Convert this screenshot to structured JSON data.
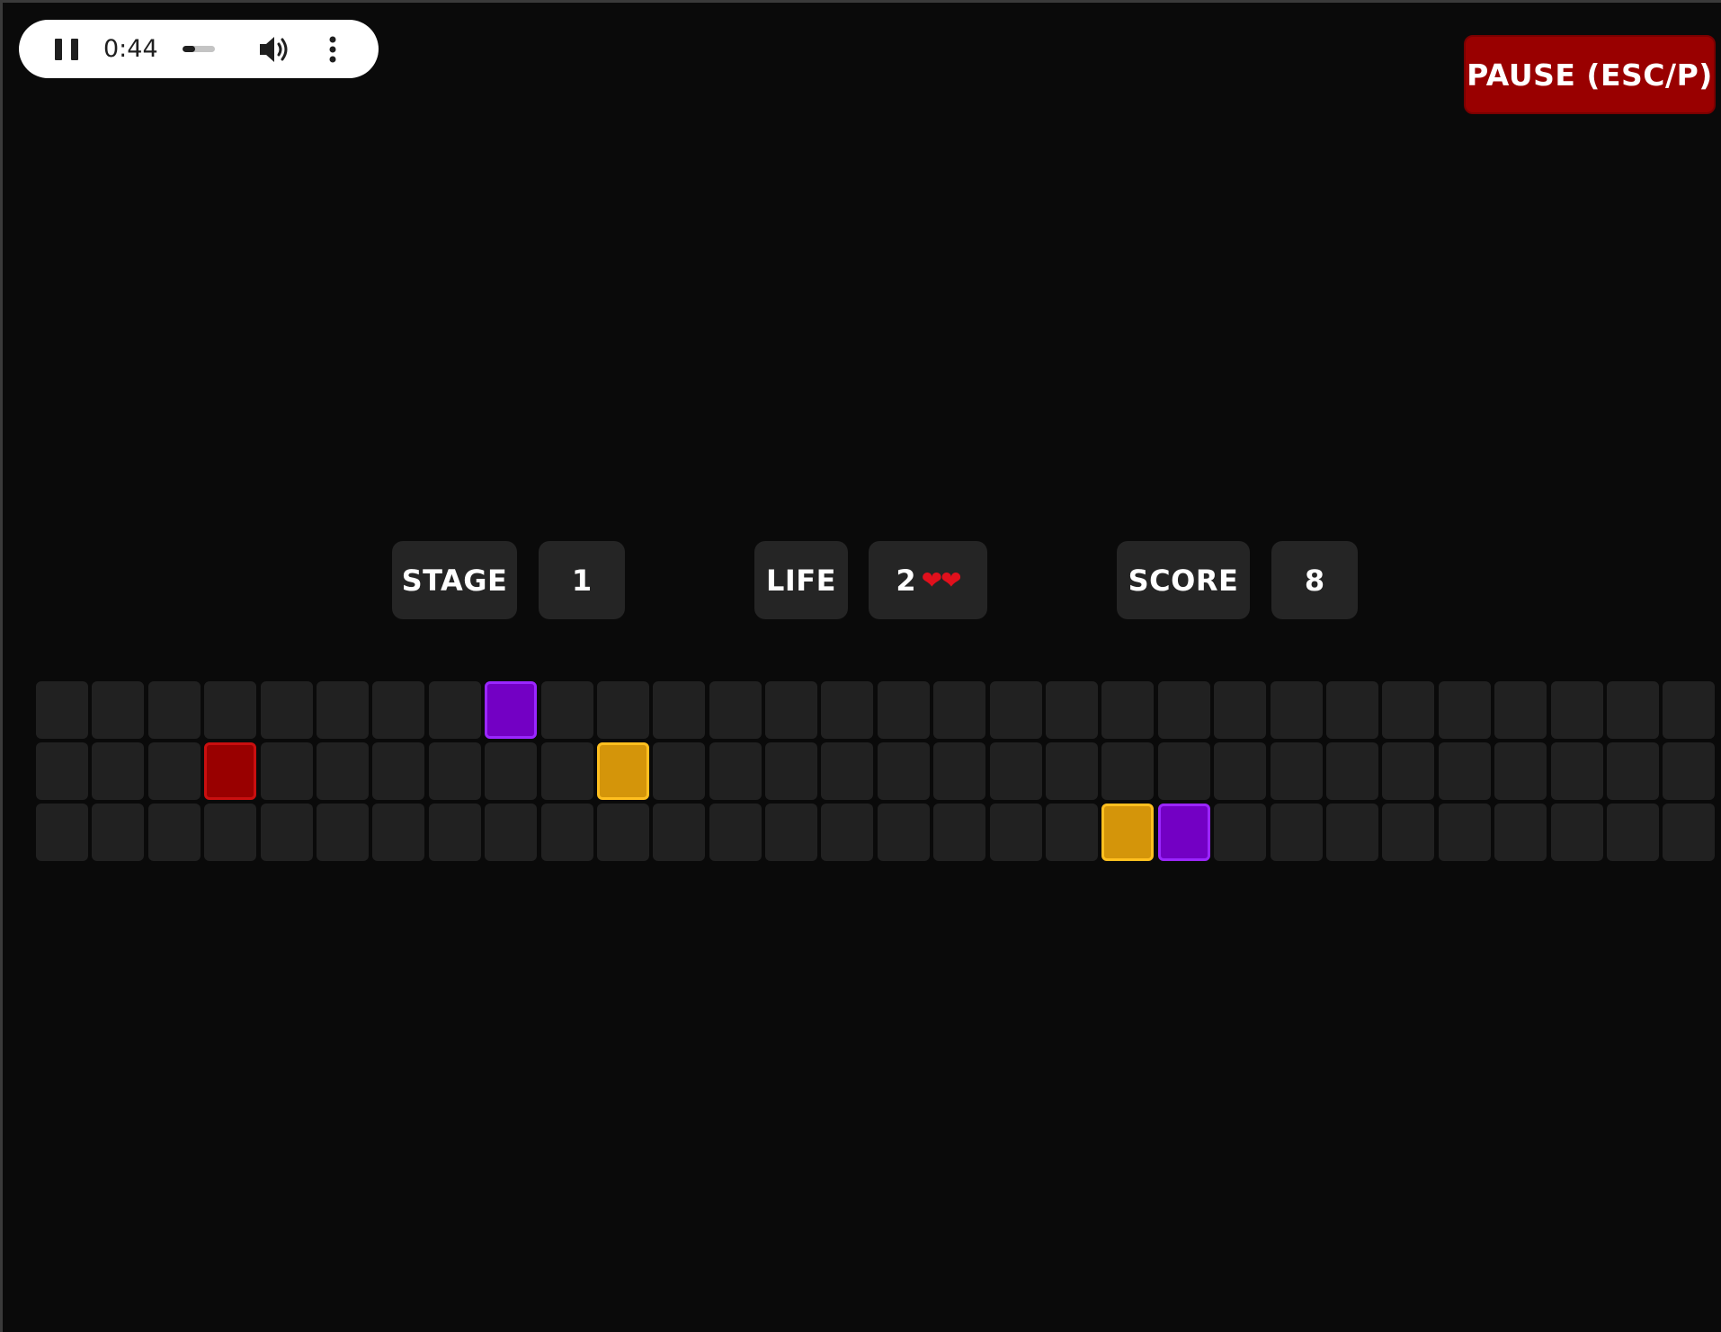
{
  "audio": {
    "time": "0:44",
    "progress": 0.4,
    "play_state_icon": "pause-icon",
    "volume_icon": "volume-icon",
    "menu_icon": "more-vert-icon"
  },
  "pause_button": {
    "label": "PAUSE (ESC/P)",
    "color": "#990000"
  },
  "hud": {
    "stage_label": "STAGE",
    "stage_value": "1",
    "life_label": "LIFE",
    "life_value": "2",
    "life_hearts": "❤❤",
    "score_label": "SCORE",
    "score_value": "8"
  },
  "board": {
    "columns": 30,
    "rows": 3,
    "blocks": [
      {
        "row": 0,
        "col": 8,
        "color": "purple"
      },
      {
        "row": 1,
        "col": 3,
        "color": "red"
      },
      {
        "row": 1,
        "col": 10,
        "color": "orange"
      },
      {
        "row": 2,
        "col": 19,
        "color": "orange"
      },
      {
        "row": 2,
        "col": 20,
        "color": "purple"
      }
    ],
    "colors": {
      "empty": "#212121",
      "purple": "#7300c4",
      "orange": "#d4950a",
      "red": "#990000"
    }
  }
}
